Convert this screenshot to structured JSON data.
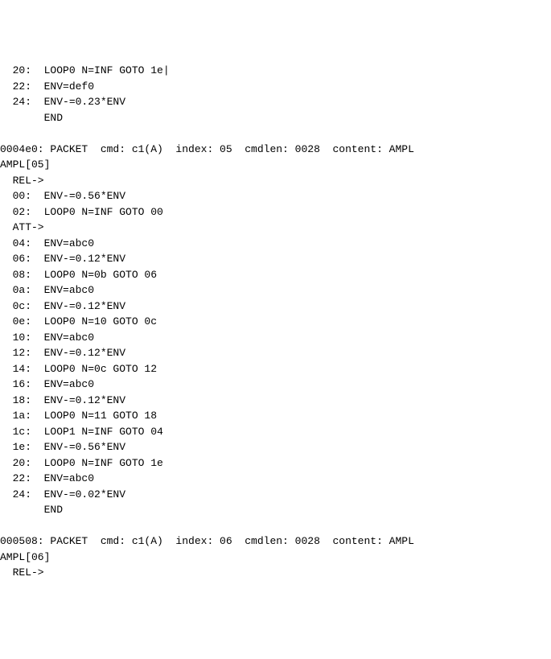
{
  "lines": [
    "  20:  LOOP0 N=INF GOTO 1e|",
    "  22:  ENV=def0",
    "  24:  ENV-=0.23*ENV",
    "       END",
    "",
    "0004e0: PACKET  cmd: c1(A)  index: 05  cmdlen: 0028  content: AMPL",
    "AMPL[05]",
    "  REL->",
    "  00:  ENV-=0.56*ENV",
    "  02:  LOOP0 N=INF GOTO 00",
    "  ATT->",
    "  04:  ENV=abc0",
    "  06:  ENV-=0.12*ENV",
    "  08:  LOOP0 N=0b GOTO 06",
    "  0a:  ENV=abc0",
    "  0c:  ENV-=0.12*ENV",
    "  0e:  LOOP0 N=10 GOTO 0c",
    "  10:  ENV=abc0",
    "  12:  ENV-=0.12*ENV",
    "  14:  LOOP0 N=0c GOTO 12",
    "  16:  ENV=abc0",
    "  18:  ENV-=0.12*ENV",
    "  1a:  LOOP0 N=11 GOTO 18",
    "  1c:  LOOP1 N=INF GOTO 04",
    "  1e:  ENV-=0.56*ENV",
    "  20:  LOOP0 N=INF GOTO 1e",
    "  22:  ENV=abc0",
    "  24:  ENV-=0.02*ENV",
    "       END",
    "",
    "000508: PACKET  cmd: c1(A)  index: 06  cmdlen: 0028  content: AMPL",
    "AMPL[06]",
    "  REL->"
  ]
}
